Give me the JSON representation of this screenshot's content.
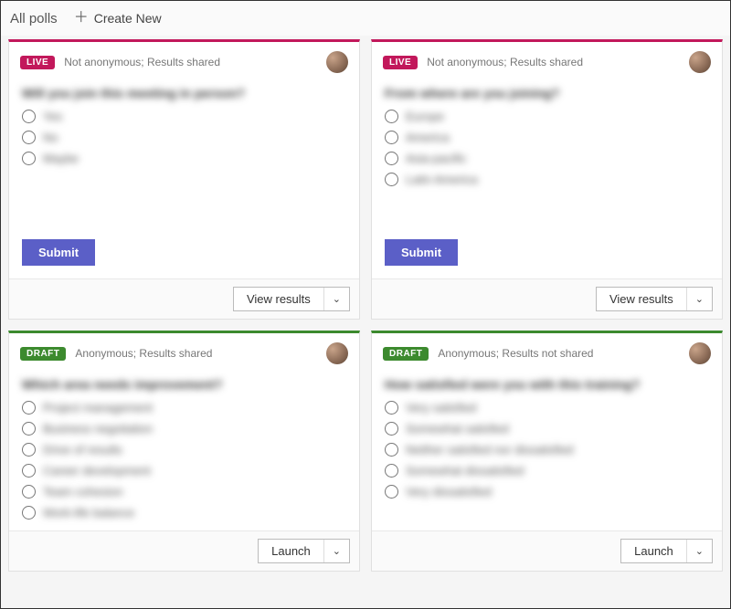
{
  "header": {
    "title": "All polls",
    "create_label": "Create New"
  },
  "badges": {
    "live": "LIVE",
    "draft": "DRAFT"
  },
  "buttons": {
    "submit": "Submit",
    "view_results": "View results",
    "launch": "Launch"
  },
  "polls": [
    {
      "status": "live",
      "meta": "Not anonymous; Results shared",
      "question": "Will you join this meeting in person?",
      "options": [
        "Yes",
        "No",
        "Maybe"
      ],
      "primary": "submit",
      "footer": "view_results"
    },
    {
      "status": "live",
      "meta": "Not anonymous; Results shared",
      "question": "From where are you joining?",
      "options": [
        "Europe",
        "America",
        "Asia-pacific",
        "Latin America"
      ],
      "primary": "submit",
      "footer": "view_results"
    },
    {
      "status": "draft",
      "meta": "Anonymous; Results shared",
      "question": "Which area needs improvement?",
      "options": [
        "Project management",
        "Business negotiation",
        "Drive of results",
        "Career development",
        "Team cohesion",
        "Work-life balance"
      ],
      "primary": null,
      "footer": "launch"
    },
    {
      "status": "draft",
      "meta": "Anonymous; Results not shared",
      "question": "How satisfied were you with this training?",
      "options": [
        "Very satisfied",
        "Somewhat satisfied",
        "Neither satisfied nor dissatisfied",
        "Somewhat dissatisfied",
        "Very dissatisfied"
      ],
      "primary": null,
      "footer": "launch"
    }
  ],
  "colors": {
    "live_accent": "#c2185b",
    "draft_accent": "#3c8a2e",
    "submit_bg": "#5b5fc7"
  }
}
